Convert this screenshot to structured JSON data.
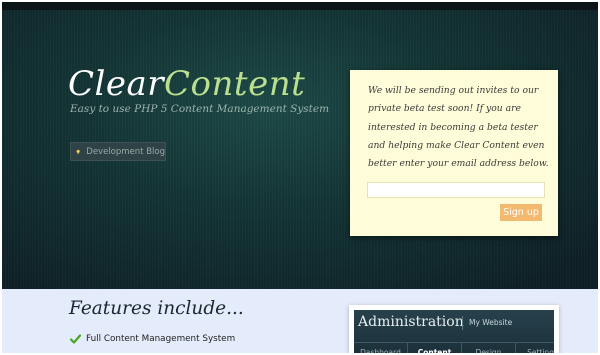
{
  "brand": {
    "name_part1": "Clear",
    "name_part2": "Content",
    "tagline": "Easy to use PHP 5 Content Management System",
    "accent_color": "#b9df8f"
  },
  "hero": {
    "blog_button": {
      "icon": "lightbulb-icon",
      "label": "Development Blog"
    }
  },
  "beta_signup": {
    "message": "We will be sending out invites to our private beta test soon! If you are interested in becoming a beta tester and helping make Clear Content even better enter your email address below.",
    "email_value": "",
    "button_label": "Sign up",
    "button_color": "#f3b96e",
    "background_color": "#fffdd9"
  },
  "features": {
    "title": "Features include...",
    "items": [
      {
        "icon": "checkmark-icon",
        "label": "Full Content Management System"
      }
    ]
  },
  "admin_preview": {
    "title": "Administration",
    "site_name": "My Website",
    "tabs": [
      "Dashboard",
      "Content",
      "Design",
      "Settings"
    ],
    "active_tab": "Content"
  }
}
